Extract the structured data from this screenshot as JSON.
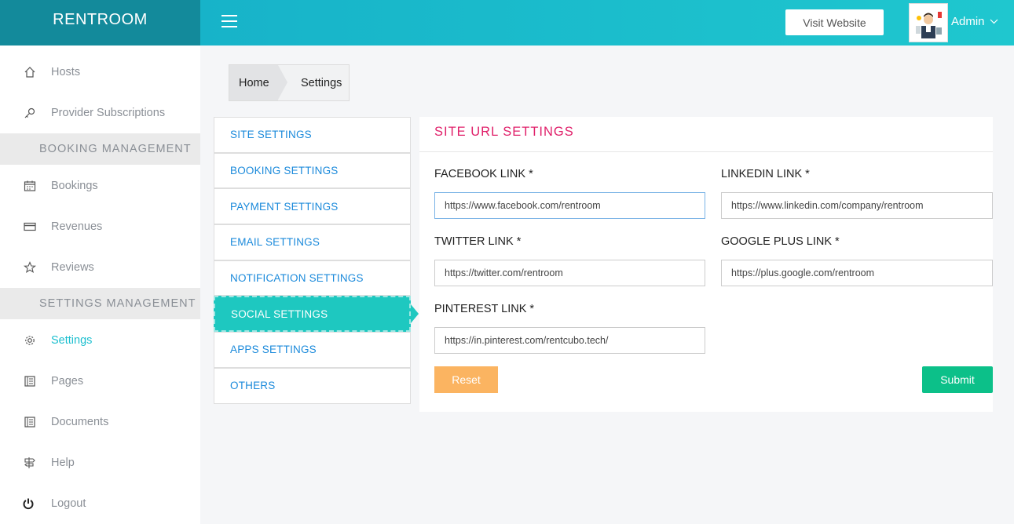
{
  "brand": "RENTROOM",
  "header": {
    "visit_website": "Visit Website",
    "admin_name": "Admin"
  },
  "sidebar": {
    "items": [
      {
        "label": "Hosts",
        "icon": "home-icon"
      },
      {
        "label": "Provider Subscriptions",
        "icon": "key-icon"
      }
    ],
    "section_booking": "BOOKING MANAGEMENT",
    "booking_items": [
      {
        "label": "Bookings",
        "icon": "calendar-icon"
      },
      {
        "label": "Revenues",
        "icon": "credit-card-icon"
      },
      {
        "label": "Reviews",
        "icon": "star-icon"
      }
    ],
    "section_settings": "SETTINGS MANAGEMENT",
    "settings_items": [
      {
        "label": "Settings",
        "icon": "gear-icon"
      },
      {
        "label": "Pages",
        "icon": "book-icon"
      },
      {
        "label": "Documents",
        "icon": "book-icon"
      },
      {
        "label": "Help",
        "icon": "signpost-icon"
      },
      {
        "label": "Logout",
        "icon": "power-icon"
      }
    ]
  },
  "breadcrumb": {
    "home": "Home",
    "current": "Settings"
  },
  "settings_menu": [
    "SITE SETTINGS",
    "BOOKING SETTINGS",
    "PAYMENT SETTINGS",
    "EMAIL SETTINGS",
    "NOTIFICATION SETTINGS",
    "SOCIAL SETTINGS",
    "APPS SETTINGS",
    "OTHERS"
  ],
  "panel": {
    "title": "SITE URL SETTINGS",
    "facebook_label": "FACEBOOK LINK *",
    "facebook_value": "https://www.facebook.com/rentroom",
    "linkedin_label": "LINKEDIN LINK *",
    "linkedin_value": "https://www.linkedin.com/company/rentroom",
    "twitter_label": "TWITTER LINK *",
    "twitter_value": "https://twitter.com/rentroom",
    "google_label": "GOOGLE PLUS LINK *",
    "google_value": "https://plus.google.com/rentroom",
    "pinterest_label": "PINTEREST LINK *",
    "pinterest_value": "https://in.pinterest.com/rentcubo.tech/",
    "reset": "Reset",
    "submit": "Submit"
  },
  "colors": {
    "accent": "#1cbfcf",
    "title": "#e0206a",
    "reset": "#fbb461",
    "submit": "#0cc089"
  }
}
